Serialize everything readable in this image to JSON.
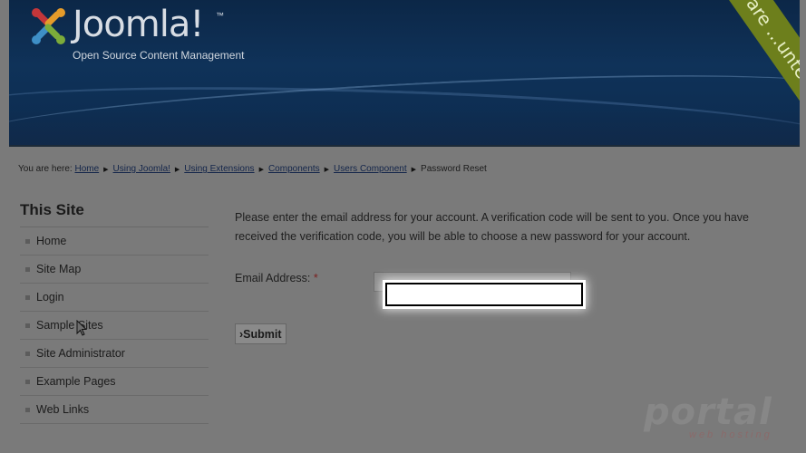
{
  "header": {
    "logo_text": "Joomla!",
    "logo_tm": "™",
    "tagline": "Open Source Content Management",
    "ribbon_text": "...e are ...unteers !"
  },
  "breadcrumb": {
    "prefix": "You are here:",
    "items": [
      "Home",
      "Using Joomla!",
      "Using Extensions",
      "Components",
      "Users Component"
    ],
    "current": "Password Reset"
  },
  "sidebar": {
    "title": "This Site",
    "items": [
      {
        "label": "Home"
      },
      {
        "label": "Site Map"
      },
      {
        "label": "Login"
      },
      {
        "label": "Sample Sites"
      },
      {
        "label": "Site Administrator"
      },
      {
        "label": "Example Pages"
      },
      {
        "label": "Web Links"
      }
    ]
  },
  "form": {
    "intro": "Please enter the email address for your account. A verification code will be sent to you. Once you have received the verification code, you will be able to choose a new password for your account.",
    "email_label": "Email Address:",
    "required_mark": "*",
    "email_value": "",
    "submit_label": "Submit"
  },
  "watermark": {
    "big": "portal",
    "small": "web hosting"
  },
  "colors": {
    "header_bg": "#0f3259",
    "ribbon": "#6d7f1c",
    "page_dim": "#7a7a7a"
  }
}
